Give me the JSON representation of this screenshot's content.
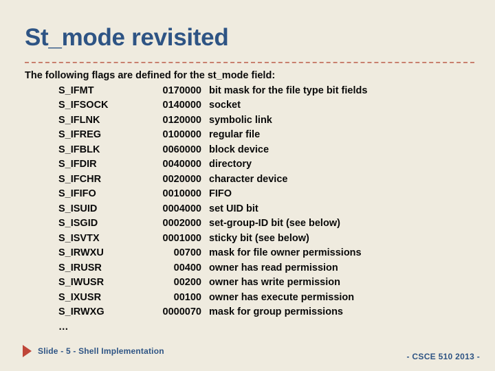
{
  "slide": {
    "title": "St_mode revisited",
    "intro": "The following flags are defined for the st_mode field:",
    "ellipsis": "…",
    "flags": [
      {
        "name": "S_IFMT",
        "value": "0170000",
        "desc": "bit mask for the file type bit fields"
      },
      {
        "name": "S_IFSOCK",
        "value": "0140000",
        "desc": "socket"
      },
      {
        "name": "S_IFLNK",
        "value": "0120000",
        "desc": "symbolic link"
      },
      {
        "name": "S_IFREG",
        "value": "0100000",
        "desc": "regular file"
      },
      {
        "name": "S_IFBLK",
        "value": "0060000",
        "desc": "block device"
      },
      {
        "name": "S_IFDIR",
        "value": "0040000",
        "desc": "directory"
      },
      {
        "name": "S_IFCHR",
        "value": "0020000",
        "desc": "character device"
      },
      {
        "name": "S_IFIFO",
        "value": "0010000",
        "desc": "FIFO"
      },
      {
        "name": "S_ISUID",
        "value": "0004000",
        "desc": "set UID bit"
      },
      {
        "name": "S_ISGID",
        "value": "0002000",
        "desc": "set-group-ID bit (see below)"
      },
      {
        "name": "S_ISVTX",
        "value": "0001000",
        "desc": "sticky bit (see below)"
      },
      {
        "name": "S_IRWXU",
        "value": "00700",
        "desc": "mask for file owner permissions"
      },
      {
        "name": "S_IRUSR",
        "value": "00400",
        "desc": "owner has read permission"
      },
      {
        "name": "S_IWUSR",
        "value": "00200",
        "desc": "owner has write permission"
      },
      {
        "name": "S_IXUSR",
        "value": "00100",
        "desc": "owner has execute permission"
      },
      {
        "name": "S_IRWXG",
        "value": "0000070",
        "desc": "mask for group permissions"
      }
    ]
  },
  "footer": {
    "bullet_icon": "play-triangle-icon",
    "left_text": "Slide -  5 -  Shell Implementation",
    "right_text": "- CSCE 510 2013 -"
  },
  "theme": {
    "background": "#efebdf",
    "title_color": "#2e5484",
    "rule_color": "#c87f6e",
    "body_color": "#0a0a0a",
    "accent_red": "#bf4639"
  }
}
